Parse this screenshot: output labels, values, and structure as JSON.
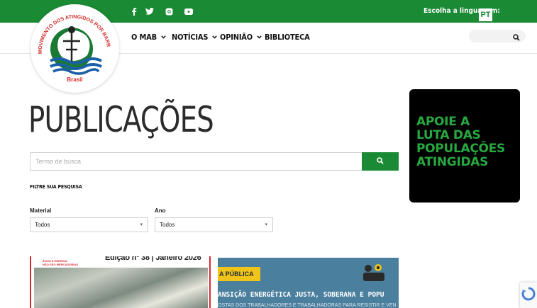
{
  "header": {
    "social": [
      {
        "name": "facebook-icon",
        "glyph": "f"
      },
      {
        "name": "twitter-icon",
        "glyph": "w"
      },
      {
        "name": "instagram-icon",
        "glyph": ""
      },
      {
        "name": "youtube-icon",
        "glyph": ""
      }
    ],
    "language_label": "Escolha a linguagem:",
    "language_value": "PT",
    "logo": {
      "arc_text": "MOVIMENTO DOS ATINGIDOS POR BARRAGENS",
      "country": "Brasil"
    },
    "nav": [
      {
        "label": "O MAB",
        "dropdown": true
      },
      {
        "label": "NOTÍCIAS",
        "dropdown": true
      },
      {
        "label": "OPINIÃO",
        "dropdown": true
      },
      {
        "label": "BIBLIOTECA",
        "dropdown": false
      }
    ],
    "search_icon": "search-icon"
  },
  "main": {
    "title": "PUBLICAÇÕES",
    "search": {
      "placeholder": "Termo de busca",
      "button_icon": "search-icon"
    },
    "filter_title": "FILTRE SUA PESQUISA",
    "filters": [
      {
        "label": "Material",
        "value": "Todos"
      },
      {
        "label": "Ano",
        "value": "Todos"
      }
    ]
  },
  "sidebar": {
    "banner_text": "APOIE A\nLUTA DAS\nPOPULAÇÕES\nATINGIDAS"
  },
  "cards": [
    {
      "edition": "Edição nº 38 | Janeiro 2026",
      "tag": "ÁGUA E ENERGIA\nNÃO SÃO MERCADORIAS"
    },
    {
      "badge": "A PÚBLICA",
      "headline": "ANSIÇÃO ENERGÉTICA JUSTA, SOBERANA E POPU",
      "subline": "OSTAS DOS TRABALHADORES E TRABALHADORAS PARA RESISTIR E VEN"
    }
  ],
  "colors": {
    "brand_green": "#1a8a34",
    "banner_text": "#27a840",
    "card_red": "#d7282f",
    "card_blue": "#4a7f9e",
    "badge_yellow": "#f0c419"
  }
}
